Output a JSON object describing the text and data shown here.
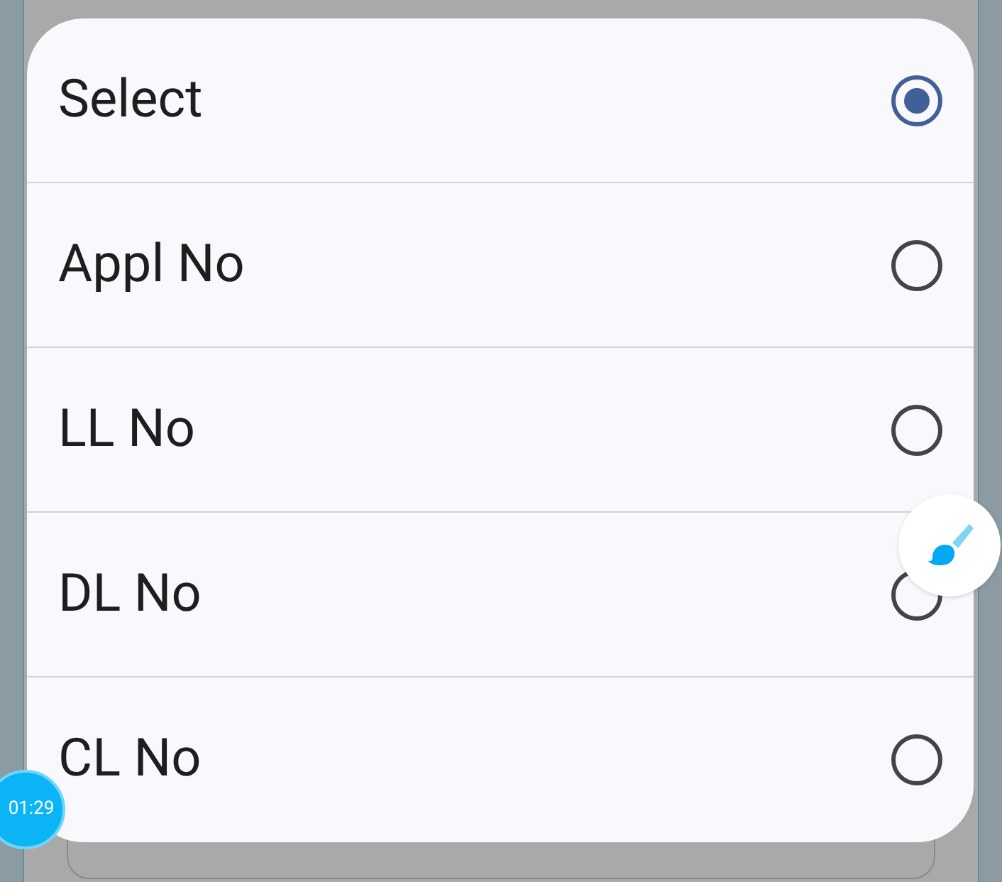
{
  "options": [
    {
      "label": "Select",
      "selected": true
    },
    {
      "label": "Appl No",
      "selected": false
    },
    {
      "label": "LL No",
      "selected": false
    },
    {
      "label": "DL No",
      "selected": false
    },
    {
      "label": "CL No",
      "selected": false
    }
  ],
  "timer": {
    "text": "01:29"
  }
}
